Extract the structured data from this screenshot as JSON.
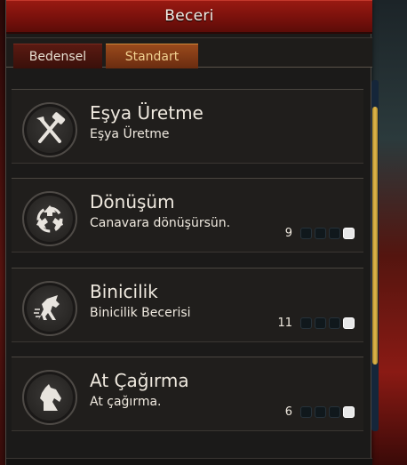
{
  "window": {
    "title": "Beceri"
  },
  "tabs": [
    {
      "label": "Bedensel",
      "active": false
    },
    {
      "label": "Standart",
      "active": true
    }
  ],
  "skills": [
    {
      "name": "Eşya Üretme",
      "description": "Eşya Üretme",
      "icon": "crossed-tools-icon",
      "level": "",
      "pips_filled": 0
    },
    {
      "name": "Dönüşüm",
      "description": "Canavara dönüşürsün.",
      "icon": "recycle-icon",
      "level": "9",
      "pips_filled": 1
    },
    {
      "name": "Binicilik",
      "description": "Binicilik Becerisi",
      "icon": "rearing-horse-icon",
      "level": "11",
      "pips_filled": 1
    },
    {
      "name": "At Çağırma",
      "description": "At çağırma.",
      "icon": "horse-head-icon",
      "level": "6",
      "pips_filled": 1
    }
  ],
  "colors": {
    "title_bar": "#9a1a12",
    "active_tab": "#9a4a1c",
    "scroll_thumb": "#e0b84c",
    "pip_on": "#e8e8e8",
    "pip_off": "#10181c"
  }
}
